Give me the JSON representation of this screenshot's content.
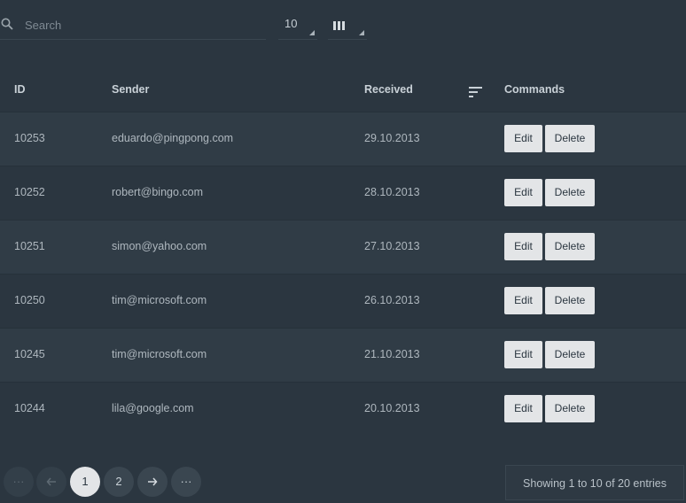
{
  "toolbar": {
    "search_placeholder": "Search",
    "rows_per_page": "10"
  },
  "table": {
    "headers": {
      "id": "ID",
      "sender": "Sender",
      "received": "Received",
      "commands": "Commands"
    },
    "rows": [
      {
        "id": "10253",
        "sender": "eduardo@pingpong.com",
        "received": "29.10.2013",
        "edit": "Edit",
        "delete": "Delete"
      },
      {
        "id": "10252",
        "sender": "robert@bingo.com",
        "received": "28.10.2013",
        "edit": "Edit",
        "delete": "Delete"
      },
      {
        "id": "10251",
        "sender": "simon@yahoo.com",
        "received": "27.10.2013",
        "edit": "Edit",
        "delete": "Delete"
      },
      {
        "id": "10250",
        "sender": "tim@microsoft.com",
        "received": "26.10.2013",
        "edit": "Edit",
        "delete": "Delete"
      },
      {
        "id": "10245",
        "sender": "tim@microsoft.com",
        "received": "21.10.2013",
        "edit": "Edit",
        "delete": "Delete"
      },
      {
        "id": "10244",
        "sender": "lila@google.com",
        "received": "20.10.2013",
        "edit": "Edit",
        "delete": "Delete"
      }
    ]
  },
  "pagination": {
    "first": "···",
    "last": "···",
    "pages": [
      "1",
      "2"
    ],
    "info": "Showing 1 to 10 of 20 entries"
  }
}
